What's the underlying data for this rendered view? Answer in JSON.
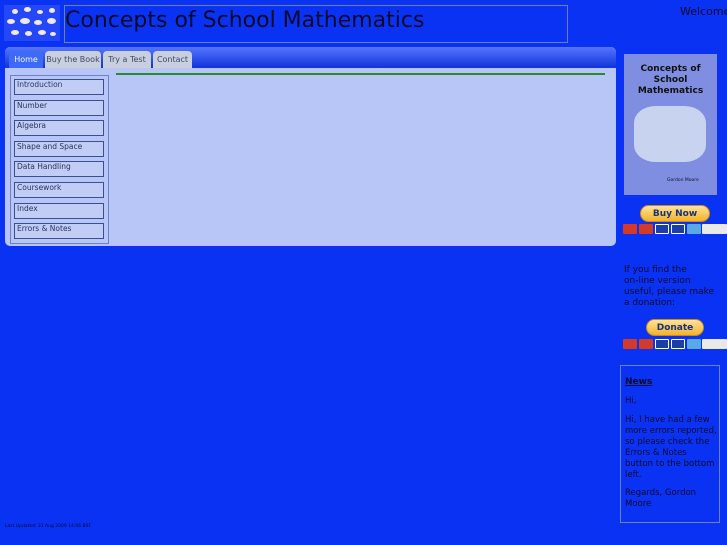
{
  "site": {
    "title": "Concepts of School Mathematics",
    "welcome": "Welcome"
  },
  "tabs": [
    {
      "label": "Home",
      "active": true
    },
    {
      "label": "Buy the Book",
      "active": false
    },
    {
      "label": "Try a Test",
      "active": false
    },
    {
      "label": "Contact",
      "active": false
    }
  ],
  "sidebar": {
    "items": [
      "Introduction",
      "Number",
      "Algebra",
      "Shape and Space",
      "Data Handling",
      "Coursework",
      "Index",
      "Errors & Notes"
    ]
  },
  "book": {
    "cover_title_1": "Concepts of",
    "cover_title_2": "School",
    "cover_title_3": "Mathematics",
    "cover_author": "Gordon Moore"
  },
  "buttons": {
    "buy_now": "Buy Now",
    "donate": "Donate"
  },
  "cards": [
    "mastercard",
    "mastercard",
    "visa",
    "visa",
    "maestro",
    "direct-debit"
  ],
  "donation": {
    "line1": "If you find the",
    "line2": "on-line version",
    "line3": "useful, please make",
    "line4": "a donation:"
  },
  "news": {
    "title": "News",
    "greeting": "Hi,",
    "body": "Hi, I have had a few more errors reported, so please check the Errors & Notes button to the bottom left.",
    "signoff": "Regards, Gordon Moore"
  },
  "footer": {
    "last_updated": "Last Updated: 31 Aug 2009 14:06 BST"
  },
  "colors": {
    "background": "#0a32f2",
    "panel": "#b7c6f6",
    "accent_line": "#2b8a2b"
  }
}
